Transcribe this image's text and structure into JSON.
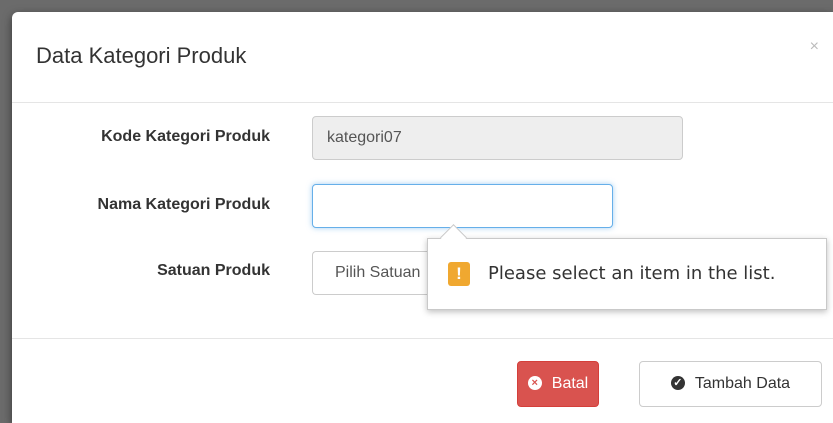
{
  "modal": {
    "title": "Data Kategori Produk",
    "close_label": "×"
  },
  "form": {
    "kode_label": "Kode Kategori Produk",
    "kode_value": "kategori07",
    "nama_label": "Nama Kategori Produk",
    "nama_value": "",
    "satuan_label": "Satuan Produk",
    "satuan_selected": "Pilih Satuan"
  },
  "validation": {
    "icon": "warning-icon",
    "icon_glyph": "!",
    "message": "Please select an item in the list.",
    "icon_color": "#f0a830"
  },
  "footer": {
    "cancel_label": "Batal",
    "cancel_icon": "times-circle-icon",
    "cancel_glyph": "×",
    "cancel_color": "#d9534f",
    "submit_label": "Tambah Data",
    "submit_icon": "check-circle-icon",
    "submit_glyph": "✓"
  }
}
